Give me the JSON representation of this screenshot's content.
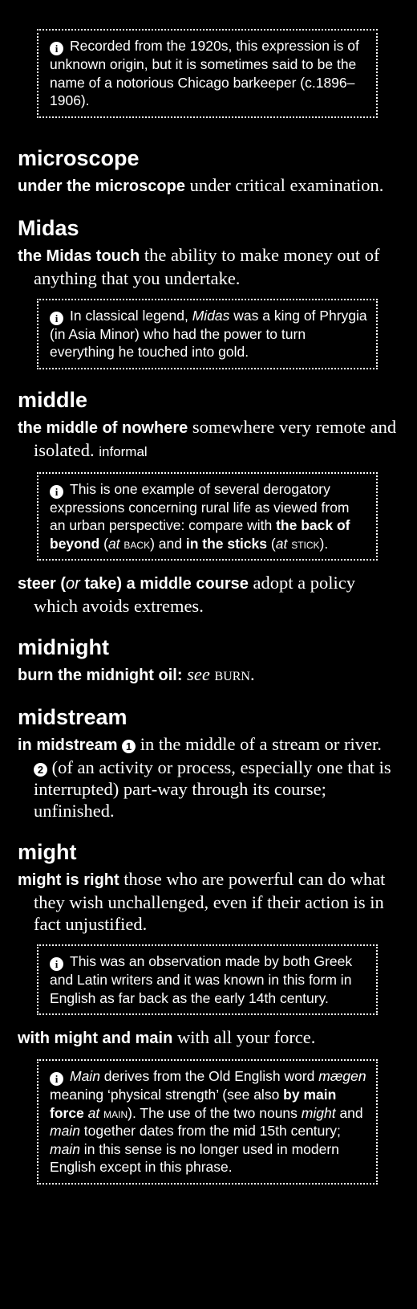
{
  "top_note": "Recorded from the 1920s, this expression is of unknown origin, but it is sometimes said to be the name of a notorious Chicago barkeeper (c.1896–1906).",
  "microscope": {
    "headword": "microscope",
    "phrase": "under the microscope",
    "definition": "under critical examination."
  },
  "midas": {
    "headword": "Midas",
    "phrase": "the Midas touch",
    "definition": "the ability to make money out of anything that you undertake.",
    "note_a": "In classical legend, ",
    "note_italic": "Midas",
    "note_b": " was a king of Phrygia (in Asia Minor) who had the power to turn everything he touched into gold."
  },
  "middle": {
    "headword": "middle",
    "phrase1": "the middle of nowhere",
    "definition1": "somewhere very remote and isolated.",
    "label1": "informal",
    "note_a": "This is one example of several derogatory expressions concerning rural life as viewed from an urban perspective: compare with ",
    "note_bold1": "the back of beyond",
    "note_b": " (",
    "note_at1": "at",
    "note_ref1": "back",
    "note_c": ") and ",
    "note_bold2": "in the sticks",
    "note_d": " (",
    "note_at2": "at",
    "note_ref2": "stick",
    "note_e": ").",
    "phrase2_a": "steer (",
    "phrase2_or": "or",
    "phrase2_b": " take) a middle course",
    "definition2": "adopt a policy which avoids extremes."
  },
  "midnight": {
    "headword": "midnight",
    "phrase": "burn the midnight oil",
    "colon": ":",
    "see": "see",
    "ref": "burn",
    "period": "."
  },
  "midstream": {
    "headword": "midstream",
    "phrase": "in midstream",
    "num1": "1",
    "sense1": "in the middle of a stream or river.",
    "num2": "2",
    "sense2": "(of an activity or process, especially one that is interrupted) part-way through its course; unfinished."
  },
  "might": {
    "headword": "might",
    "phrase1": "might is right",
    "definition1": "those who are powerful can do what they wish unchallenged, even if their action is in fact unjustified.",
    "note1": "This was an observation made by both Greek and Latin writers and it was known in this form in English as far back as the early 14th century.",
    "phrase2": "with might and main",
    "definition2": "with all your force.",
    "note2_it1": "Main",
    "note2_a": " derives from the Old English word ",
    "note2_it2": "mægen",
    "note2_b": " meaning ‘physical strength’ (see also ",
    "note2_bold": "by main force",
    "note2_at": "at",
    "note2_ref": "main",
    "note2_c": "). The use of the two nouns ",
    "note2_it3": "might",
    "note2_d": " and ",
    "note2_it4": "main",
    "note2_e": " together dates from the mid 15th century; ",
    "note2_it5": "main",
    "note2_f": " in this sense is no longer used in modern English except in this phrase."
  }
}
